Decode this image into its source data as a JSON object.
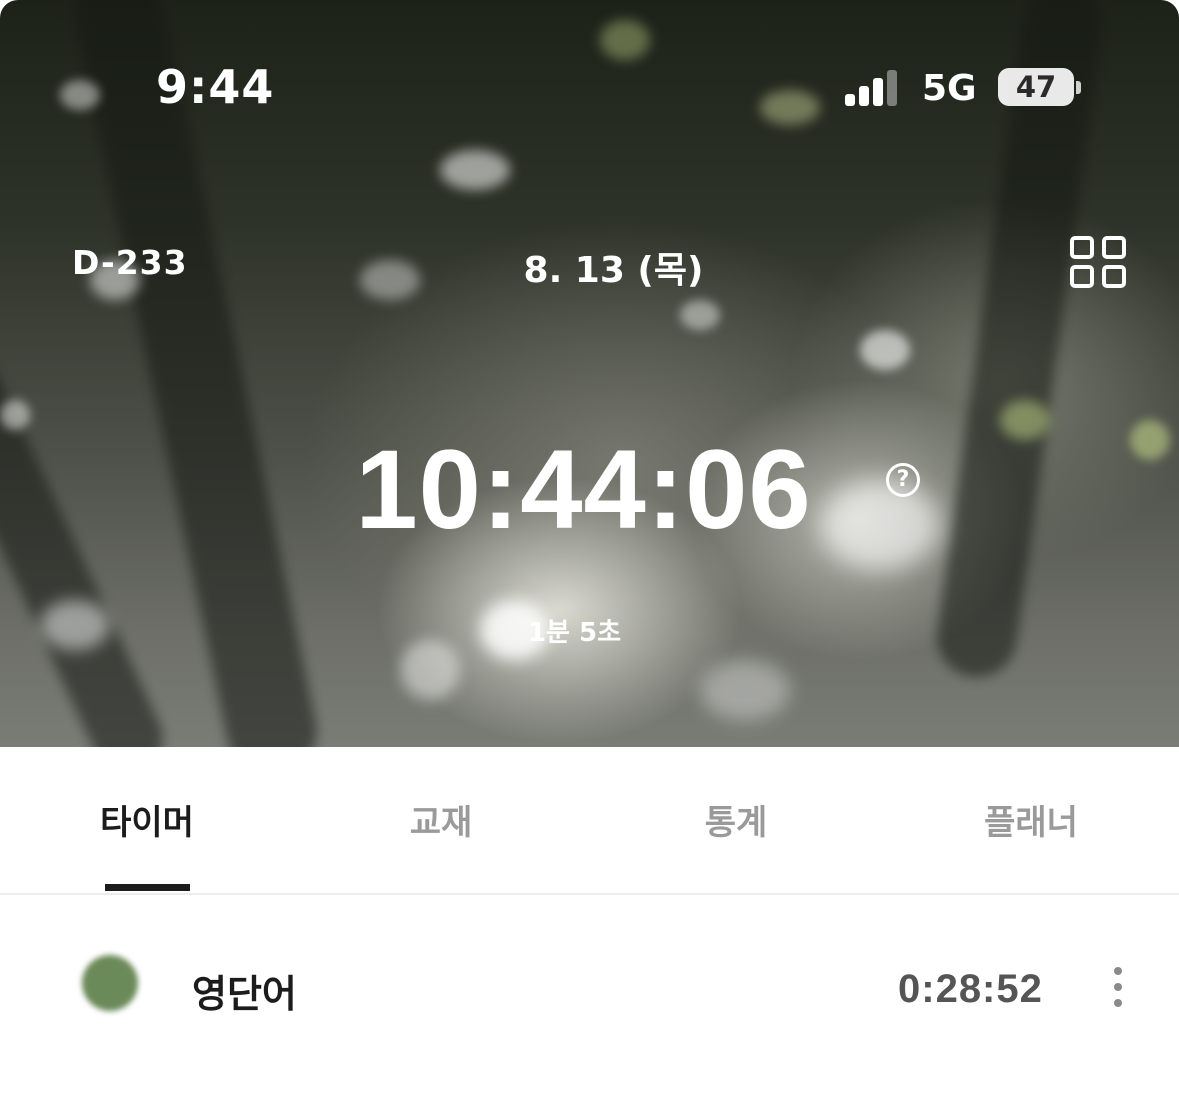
{
  "status_bar": {
    "time": "9:44",
    "network": "5G",
    "battery": "47"
  },
  "header": {
    "dday": "D-233",
    "date": "8. 13 (목)",
    "menu_icon": "grid-icon"
  },
  "timer": {
    "total": "10:44:06",
    "help_glyph": "?",
    "elapsed": "1분 5초"
  },
  "tabs": [
    {
      "label": "타이머",
      "active": true
    },
    {
      "label": "교재",
      "active": false
    },
    {
      "label": "통계",
      "active": false
    },
    {
      "label": "플래너",
      "active": false
    }
  ],
  "subjects": [
    {
      "name": "영단어",
      "time": "0:28:52",
      "color": "#6b8a59"
    }
  ],
  "colors": {
    "accent": "#1c1c1c",
    "inactive_tab": "#9a9a9a"
  }
}
